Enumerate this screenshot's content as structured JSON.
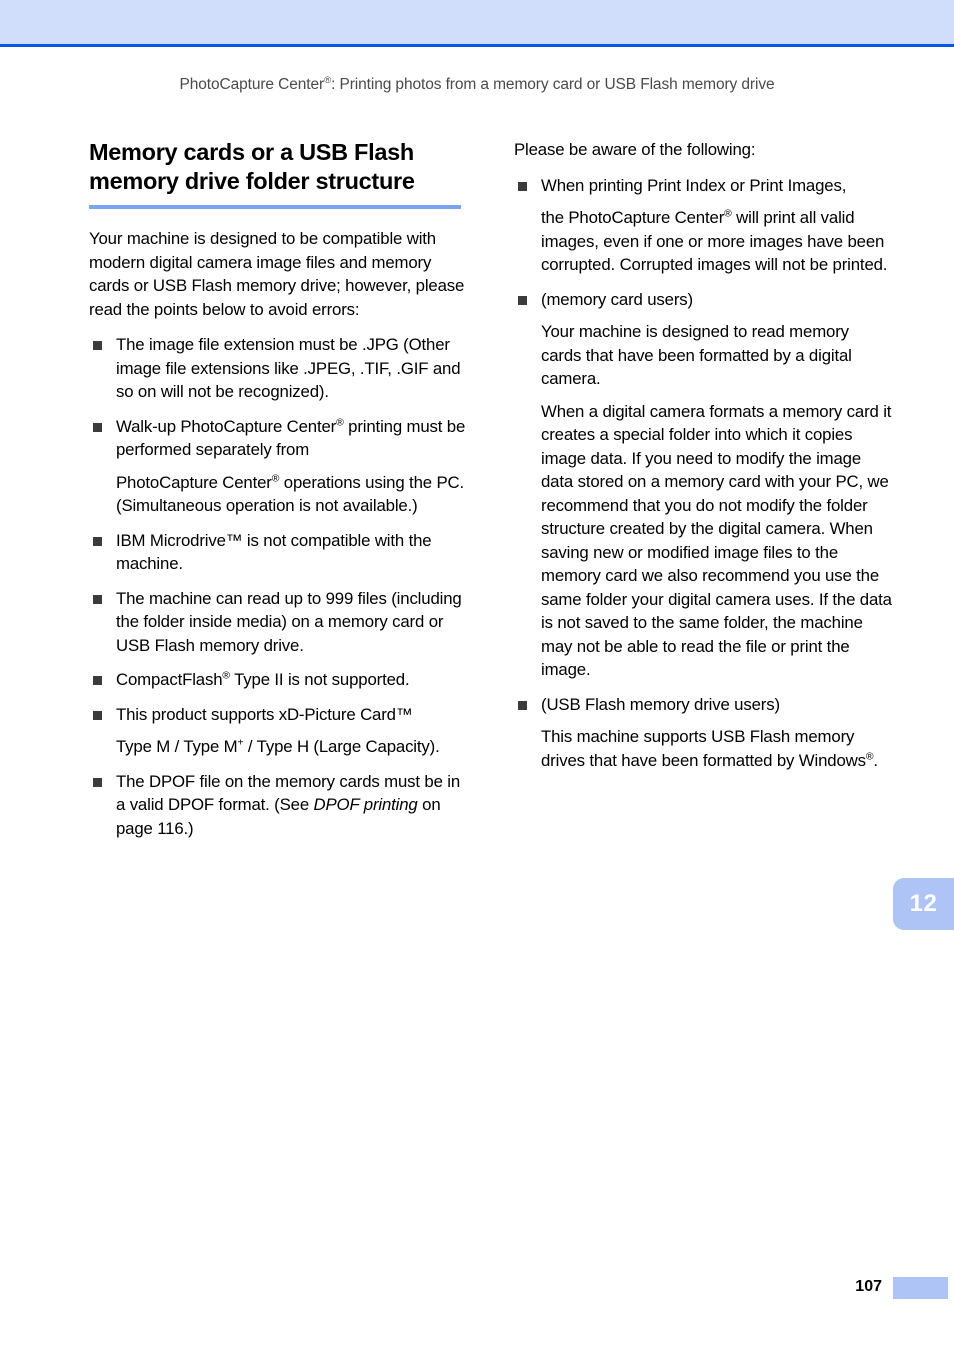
{
  "header": {
    "running_head_parts": {
      "before": "PhotoCapture Center",
      "sup": "®",
      "after": ": Printing photos from a memory card or USB Flash memory drive"
    },
    "band_color": "#d0ddfb",
    "rule_color": "#0b57e8"
  },
  "left_column": {
    "heading_line1": "Memory cards or a USB Flash",
    "heading_line2": "memory drive folder structure",
    "heading_rule_color": "#7ba3f0",
    "intro": "Your machine is designed to be compatible with modern digital camera image files and memory cards or USB Flash memory drive; however, please read the points below to avoid errors:",
    "bullets": [
      {
        "id": "file-extension",
        "text": "The image file extension must be .JPG (Other image file extensions like .JPEG, .TIF, .GIF and so on will not be recognized)."
      },
      {
        "id": "walk-up",
        "text_part1": "Walk-up PhotoCapture Center",
        "sup1": "®",
        "text_part2": " printing must be performed separately from",
        "text_part3": "PhotoCapture Center",
        "sup2": "®",
        "text_part4": " operations using the PC. (Simultaneous operation is not available.)"
      },
      {
        "id": "ibm-microdrive",
        "text": "IBM Microdrive™ is not compatible with the machine."
      },
      {
        "id": "999-files",
        "text": "The machine can read up to 999 files (including the folder inside media) on a memory card or USB Flash memory drive."
      },
      {
        "id": "compactflash",
        "text_part1": "CompactFlash",
        "sup1": "®",
        "text_part2": " Type II is not supported."
      },
      {
        "id": "xd-picture-card",
        "text_part1": "This product supports xD-Picture Card™",
        "text_part2": "Type M / Type M",
        "sup1": "+",
        "text_part3": " / Type H (Large Capacity)."
      },
      {
        "id": "dpof",
        "text_part1": "The DPOF file on the memory cards must be in a valid DPOF format. (See ",
        "italic": "DPOF printing",
        "text_part2": " on page 116.)"
      }
    ]
  },
  "right_column": {
    "intro": "Please be aware of the following:",
    "bullets": [
      {
        "id": "print-index",
        "text_part1": "When printing Print Index or Print Images,",
        "text_part2": "the PhotoCapture Center",
        "sup1": "®",
        "text_part3": " will print all valid images, even if one or more images have been corrupted. Corrupted images will not be printed."
      },
      {
        "id": "memory-card-users",
        "label": "(memory card users)",
        "paragraphs": [
          "Your machine is designed to read memory cards that have been formatted by a digital camera.",
          "When a digital camera formats a memory card it creates a special folder into which it copies image data. If you need to modify the image data stored on a memory card with your PC, we recommend that you do not modify the folder structure created by the digital camera. When saving new or modified image files to the memory card we also recommend you use the same folder your digital camera uses. If the data is not saved to the same folder, the machine may not be able to read the file or print the image."
        ]
      },
      {
        "id": "usb-flash-users",
        "label": "(USB Flash memory drive users)",
        "paragraph_part1": "This machine supports USB Flash memory drives that have been formatted by Windows",
        "sup1": "®",
        "paragraph_part2": "."
      }
    ]
  },
  "chapter_tab": {
    "number": "12",
    "color": "#aec4f7",
    "text_color": "#ffffff"
  },
  "footer": {
    "page_number": "107",
    "block_color": "#aec4f7"
  }
}
